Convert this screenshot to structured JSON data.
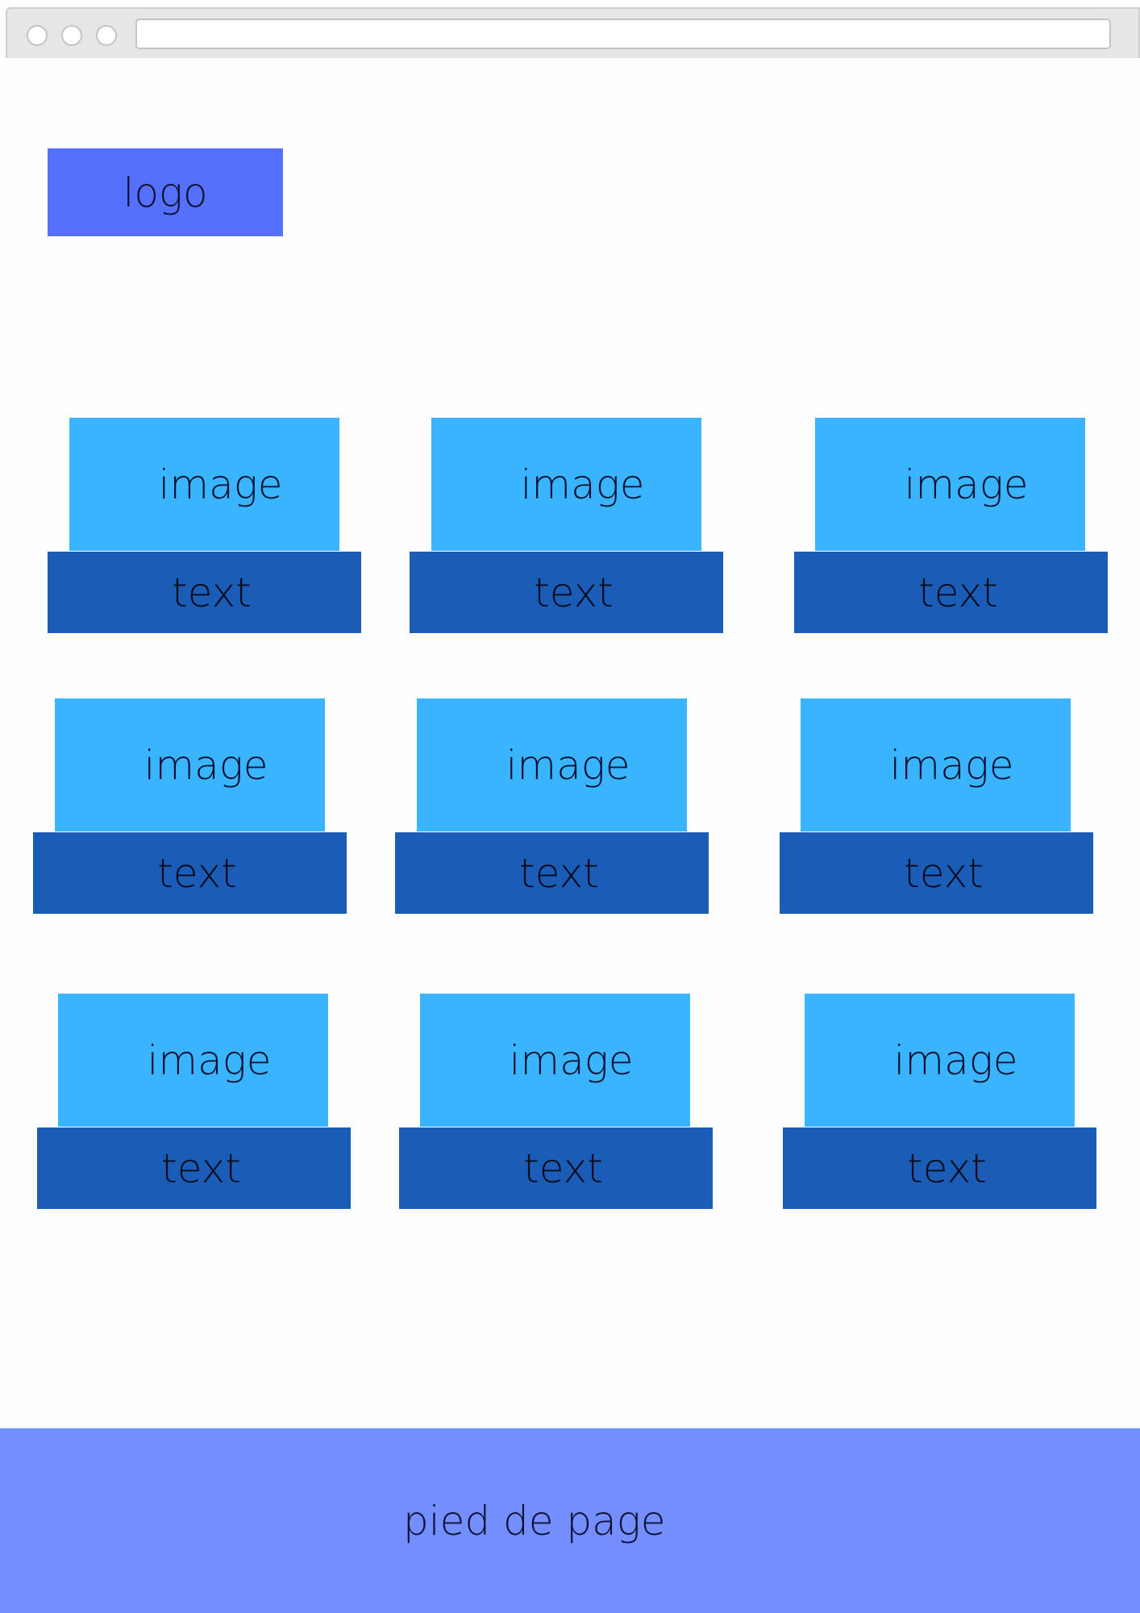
{
  "header": {
    "logo_label": "logo"
  },
  "grid": {
    "cards": [
      {
        "image_label": "image",
        "text_label": "text"
      },
      {
        "image_label": "image",
        "text_label": "text"
      },
      {
        "image_label": "image",
        "text_label": "text"
      },
      {
        "image_label": "image",
        "text_label": "text"
      },
      {
        "image_label": "image",
        "text_label": "text"
      },
      {
        "image_label": "image",
        "text_label": "text"
      },
      {
        "image_label": "image",
        "text_label": "text"
      },
      {
        "image_label": "image",
        "text_label": "text"
      },
      {
        "image_label": "image",
        "text_label": "text"
      }
    ]
  },
  "footer": {
    "label": "pied de page"
  },
  "colors": {
    "logo": "#5470fd",
    "image_block": "#38b5fe",
    "text_block": "#1a5db6",
    "footer": "#738fff"
  }
}
